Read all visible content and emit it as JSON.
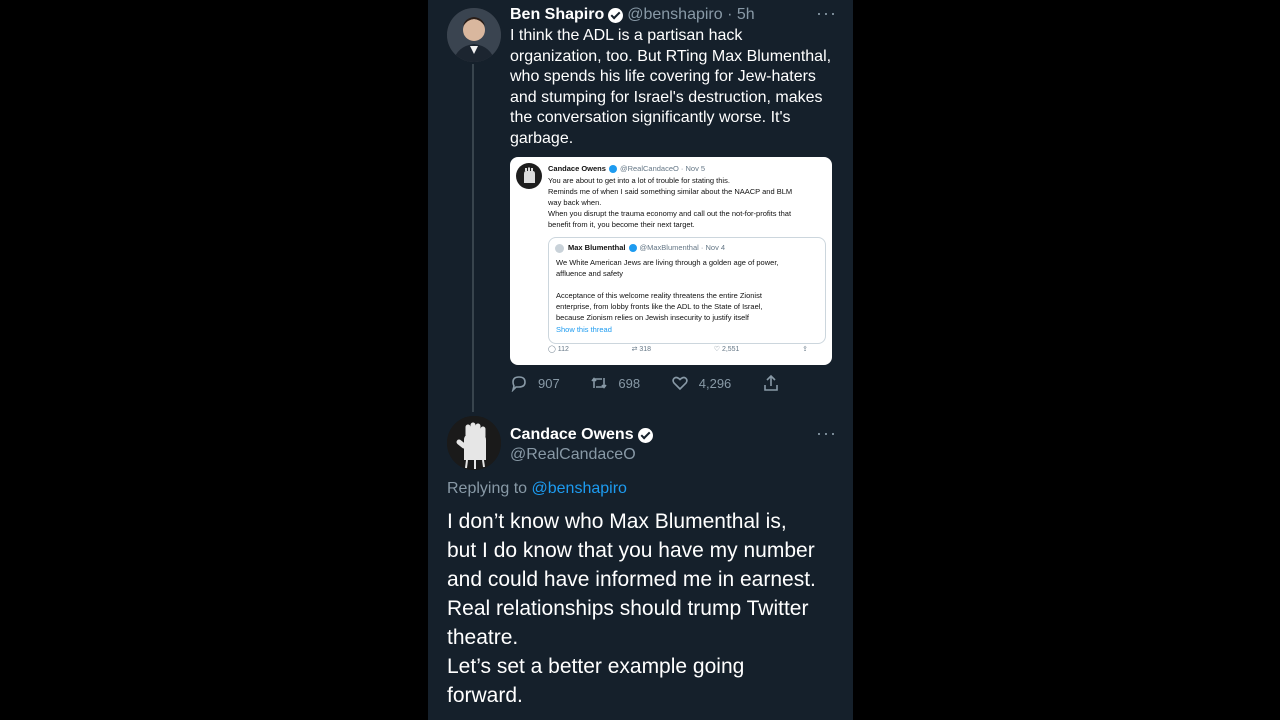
{
  "tweet1": {
    "author_name": "Ben Shapiro",
    "handle_time": "@benshapiro · 5h",
    "more_label": "···",
    "text": "I think the ADL is a partisan hack\norganization, too. But RTing Max Blumenthal,\nwho spends his life covering for Jew-haters\nand stumping for Israel's destruction, makes\nthe conversation significantly worse. It's\ngarbage.",
    "quoted": {
      "author_name": "Candace Owens",
      "handle_time": "@RealCandaceO · Nov 5",
      "text": "You are about to get into a lot of trouble for stating this.\nReminds me of when I said something similar about the NAACP and BLM\nway back when.\nWhen you disrupt the trauma economy and call out the not-for-profits that\nbenefit from it, you become their next target.",
      "inner": {
        "author_name": "Max Blumenthal",
        "handle_time": "@MaxBlumenthal · Nov 4",
        "text": "We White American Jews are living through a golden age of power,\naffluence and safety\n\nAcceptance of this welcome reality threatens the entire Zionist\nenterprise, from lobby fronts like the ADL to the State of Israel,\nbecause Zionism relies on Jewish insecurity to justify itself",
        "show_thread": "Show this thread"
      },
      "stats": {
        "replies": "112",
        "retweets": "318",
        "likes": "2,551"
      }
    },
    "stats": {
      "replies": "907",
      "retweets": "698",
      "likes": "4,296"
    }
  },
  "tweet2": {
    "author_name": "Candace Owens",
    "handle": "@RealCandaceO",
    "more_label": "···",
    "replying_prefix": "Replying to ",
    "replying_to": "@benshapiro",
    "text": "I don’t know who Max Blumenthal is,\nbut I do know that you have my number\nand could have informed me in earnest.\nReal relationships should trump Twitter\ntheatre.\nLet’s set a better example going\nforward."
  },
  "colors": {
    "background": "#15202b",
    "accent": "#1d9bf0",
    "muted": "#8899a6"
  }
}
